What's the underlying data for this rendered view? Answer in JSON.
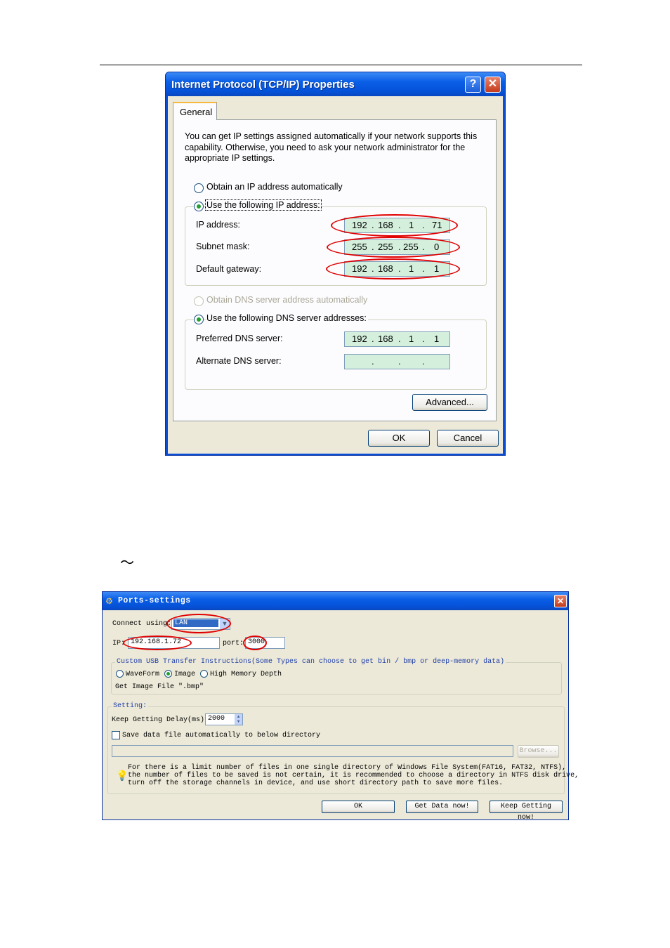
{
  "tcpip_dialog": {
    "title": "Internet Protocol (TCP/IP) Properties",
    "help_label": "?",
    "close_label": "✕",
    "tab_general": "General",
    "description": "You can get IP settings assigned automatically if your network supports this capability. Otherwise, you need to ask your network administrator for the appropriate IP settings.",
    "radio_obtain_ip": "Obtain an IP address automatically",
    "radio_use_ip": "Use the following IP address:",
    "ip_label": "IP address:",
    "ip_value": [
      "192",
      "168",
      "1",
      "71"
    ],
    "subnet_label": "Subnet mask:",
    "subnet_value": [
      "255",
      "255",
      "255",
      "0"
    ],
    "gateway_label": "Default gateway:",
    "gateway_value": [
      "192",
      "168",
      "1",
      "1"
    ],
    "radio_obtain_dns": "Obtain DNS server address automatically",
    "radio_use_dns": "Use the following DNS server addresses:",
    "preferred_dns_label": "Preferred DNS server:",
    "preferred_dns_value": [
      "192",
      "168",
      "1",
      "1"
    ],
    "alternate_dns_label": "Alternate DNS server:",
    "advanced_button": "Advanced...",
    "ok_button": "OK",
    "cancel_button": "Cancel"
  },
  "tilde": "～",
  "ports_dialog": {
    "title": "Ports-settings",
    "close_label": "✕",
    "connect_using_label": "Connect using:",
    "connect_using_value": "LAN",
    "ip_label": "IP:",
    "ip_value": "192.168.1.72",
    "port_label": "port:",
    "port_value": "3000",
    "usb_group_title": "Custom USB Transfer Instructions(Some Types can choose to get bin / bmp or deep-memory data)",
    "opt_waveform": "WaveForm",
    "opt_image": "Image",
    "opt_memory": "High Memory Depth",
    "get_image_file": "Get Image File \".bmp\"",
    "setting_group_title": "Setting:",
    "keep_delay_label": "Keep Getting Delay(ms):",
    "keep_delay_value": "2000",
    "save_checkbox_label": "Save data file automatically to below directory",
    "browse_button": "Browse...",
    "note_lines": [
      "For there is a limit number of files in one single directory of Windows File System(FAT16, FAT32, NTFS),",
      "the number of  files to be saved is not certain,  it is recommended to choose a directory in NTFS disk drive,",
      "turn off the storage channels in device, and use short directory path to save more files."
    ],
    "ok_button": "OK",
    "get_data_button": "Get Data now!",
    "keep_getting_button": "Keep Getting now!"
  },
  "colors": {
    "highlight_oval": "#e00000",
    "titlebar": "#0a5ee6",
    "ip_field_bg": "#d4f0dc"
  }
}
